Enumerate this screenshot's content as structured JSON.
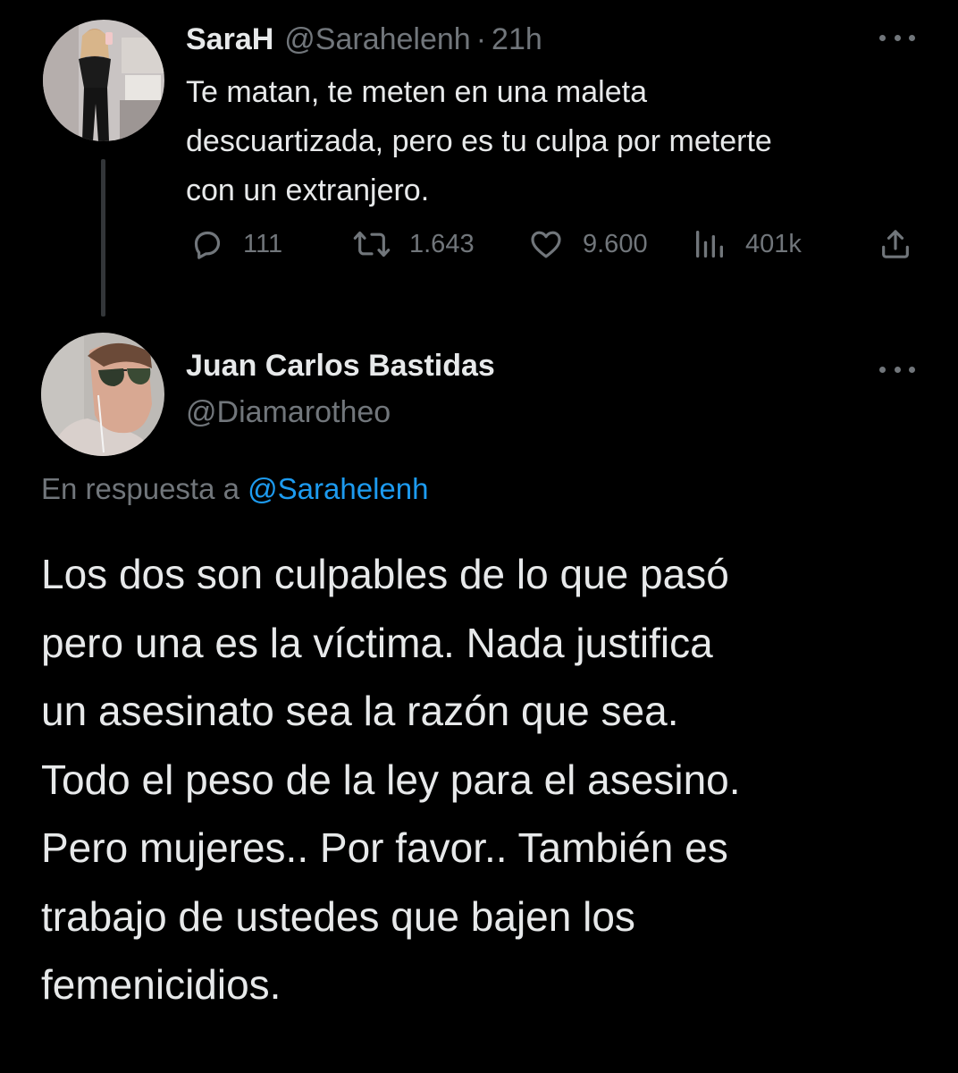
{
  "parent_tweet": {
    "display_name": "SaraH",
    "handle": "@Sarahelenh",
    "separator": "·",
    "time": "21h",
    "text_lines": [
      "Te matan, te meten en una maleta",
      "descuartizada, pero es tu culpa por meterte",
      "con un extranjero."
    ],
    "actions": {
      "replies": "111",
      "retweets": "1.643",
      "likes": "9.600",
      "views": "401k"
    }
  },
  "reply_tweet": {
    "display_name": "Juan Carlos Bastidas",
    "handle": "@Diamarotheo",
    "replying_to_prefix": "En respuesta a",
    "replying_to_handle": "@Sarahelenh",
    "text_lines": [
      "Los dos son culpables de lo que pasó",
      "pero una es la víctima. Nada justifica",
      "un asesinato sea la razón que sea.",
      "Todo el peso de la ley para el asesino.",
      "Pero mujeres.. Por favor.. También es",
      "trabajo de ustedes que bajen los",
      "femenicidios."
    ]
  },
  "colors": {
    "background": "#000000",
    "primary_text": "#e7e9ea",
    "secondary_text": "#71767b",
    "link": "#1d9bf0",
    "thread_line": "#333639"
  },
  "icons": {
    "reply": "speech-bubble-icon",
    "retweet": "retweet-arrows-icon",
    "like": "heart-outline-icon",
    "views": "bar-chart-icon",
    "share": "share-upload-icon",
    "more": "more-dots-icon"
  }
}
